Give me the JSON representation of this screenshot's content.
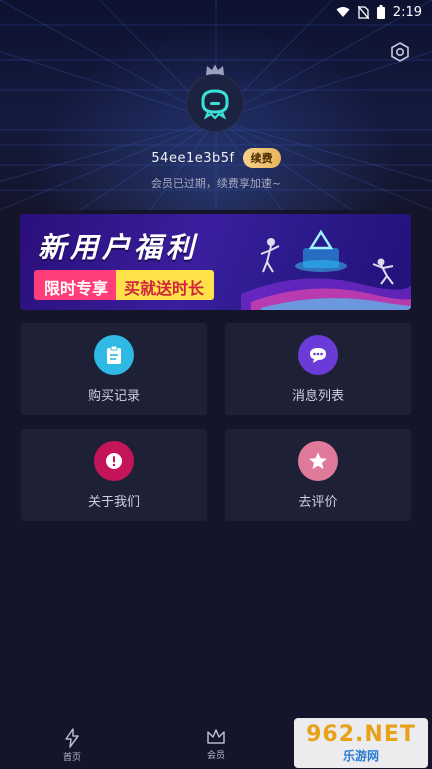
{
  "status_bar": {
    "time": "2:19",
    "icons": [
      "wifi-icon",
      "no-sim-icon",
      "battery-icon"
    ]
  },
  "header": {
    "settings_icon": "settings-hexagon-icon",
    "crown_icon": "crown-icon",
    "avatar_icon": "robot-avatar-icon"
  },
  "profile": {
    "username": "54ee1e3b5f",
    "renew_label": "续费",
    "expired_note": "会员已过期，续费享加速~"
  },
  "banner": {
    "title": "新用户福利",
    "pill_left": "限时专享",
    "pill_right": "买就送时长"
  },
  "tiles": [
    {
      "label": "购买记录",
      "icon": "clipboard-icon",
      "color": "#2fb9e5"
    },
    {
      "label": "消息列表",
      "icon": "chat-bubble-icon",
      "color": "#6a3bd6"
    },
    {
      "label": "关于我们",
      "icon": "exclamation-icon",
      "color": "#c4145a"
    },
    {
      "label": "去评价",
      "icon": "star-icon",
      "color": "#e07a9a"
    }
  ],
  "bottom_nav": [
    {
      "label": "首页",
      "icon": "lightning-icon"
    },
    {
      "label": "会员",
      "icon": "crown-icon"
    }
  ],
  "watermark": {
    "text": "962.NET",
    "subtext": "乐游网"
  },
  "colors": {
    "background": "#14152b",
    "tile_bg": "#1e2035",
    "accent_teal": "#3de0d4",
    "renew_gold": "#f6d28c"
  }
}
